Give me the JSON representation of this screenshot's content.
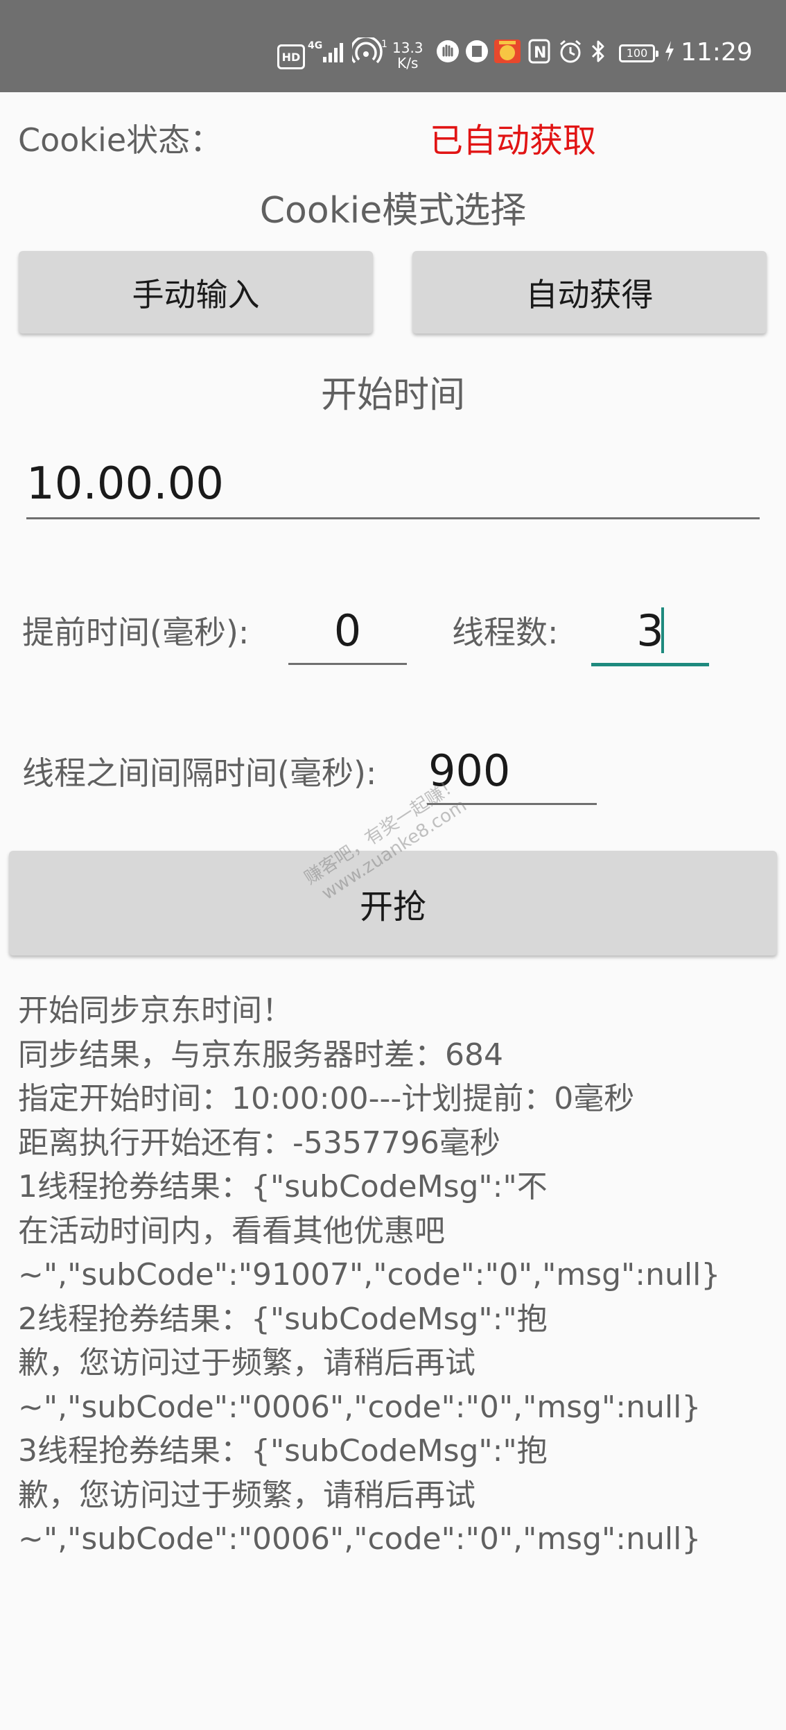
{
  "status_bar": {
    "hd": "HD",
    "network_type": "4G",
    "hotspot_badge": "1",
    "speed_value": "13.3",
    "speed_unit": "K/s",
    "nfc": "N",
    "battery": "100",
    "time": "11:29"
  },
  "cookie": {
    "status_label": "Cookie状态：",
    "status_value": "已自动获取",
    "status_color": "#e11414",
    "mode_title": "Cookie模式选择",
    "manual_button": "手动输入",
    "auto_button": "自动获得"
  },
  "start_time": {
    "title": "开始时间",
    "value": "10.00.00"
  },
  "params": {
    "advance_label": "提前时间(毫秒):",
    "advance_value": "0",
    "threads_label": "线程数:",
    "threads_value": "3",
    "interval_label": "线程之间间隔时间(毫秒):",
    "interval_value": "900",
    "focus_color": "#1e8a7e"
  },
  "start_button": "开抢",
  "watermark": {
    "line1": "赚客吧，有奖一起赚！",
    "line2": "www.zuanke8.com"
  },
  "log_lines": [
    "开始同步京东时间！",
    "同步结果，与京东服务器时差：684",
    "指定开始时间：10:00:00---计划提前：0毫秒",
    "距离执行开始还有：-5357796毫秒",
    "1线程抢券结果：{\"subCodeMsg\":\"不",
    "在活动时间内，看看其他优惠吧",
    "~\",\"subCode\":\"91007\",\"code\":\"0\",\"msg\":null}",
    "2线程抢券结果：{\"subCodeMsg\":\"抱",
    "歉，您访问过于频繁，请稍后再试",
    "~\",\"subCode\":\"0006\",\"code\":\"0\",\"msg\":null}",
    "3线程抢券结果：{\"subCodeMsg\":\"抱",
    "歉，您访问过于频繁，请稍后再试",
    "~\",\"subCode\":\"0006\",\"code\":\"0\",\"msg\":null}"
  ]
}
